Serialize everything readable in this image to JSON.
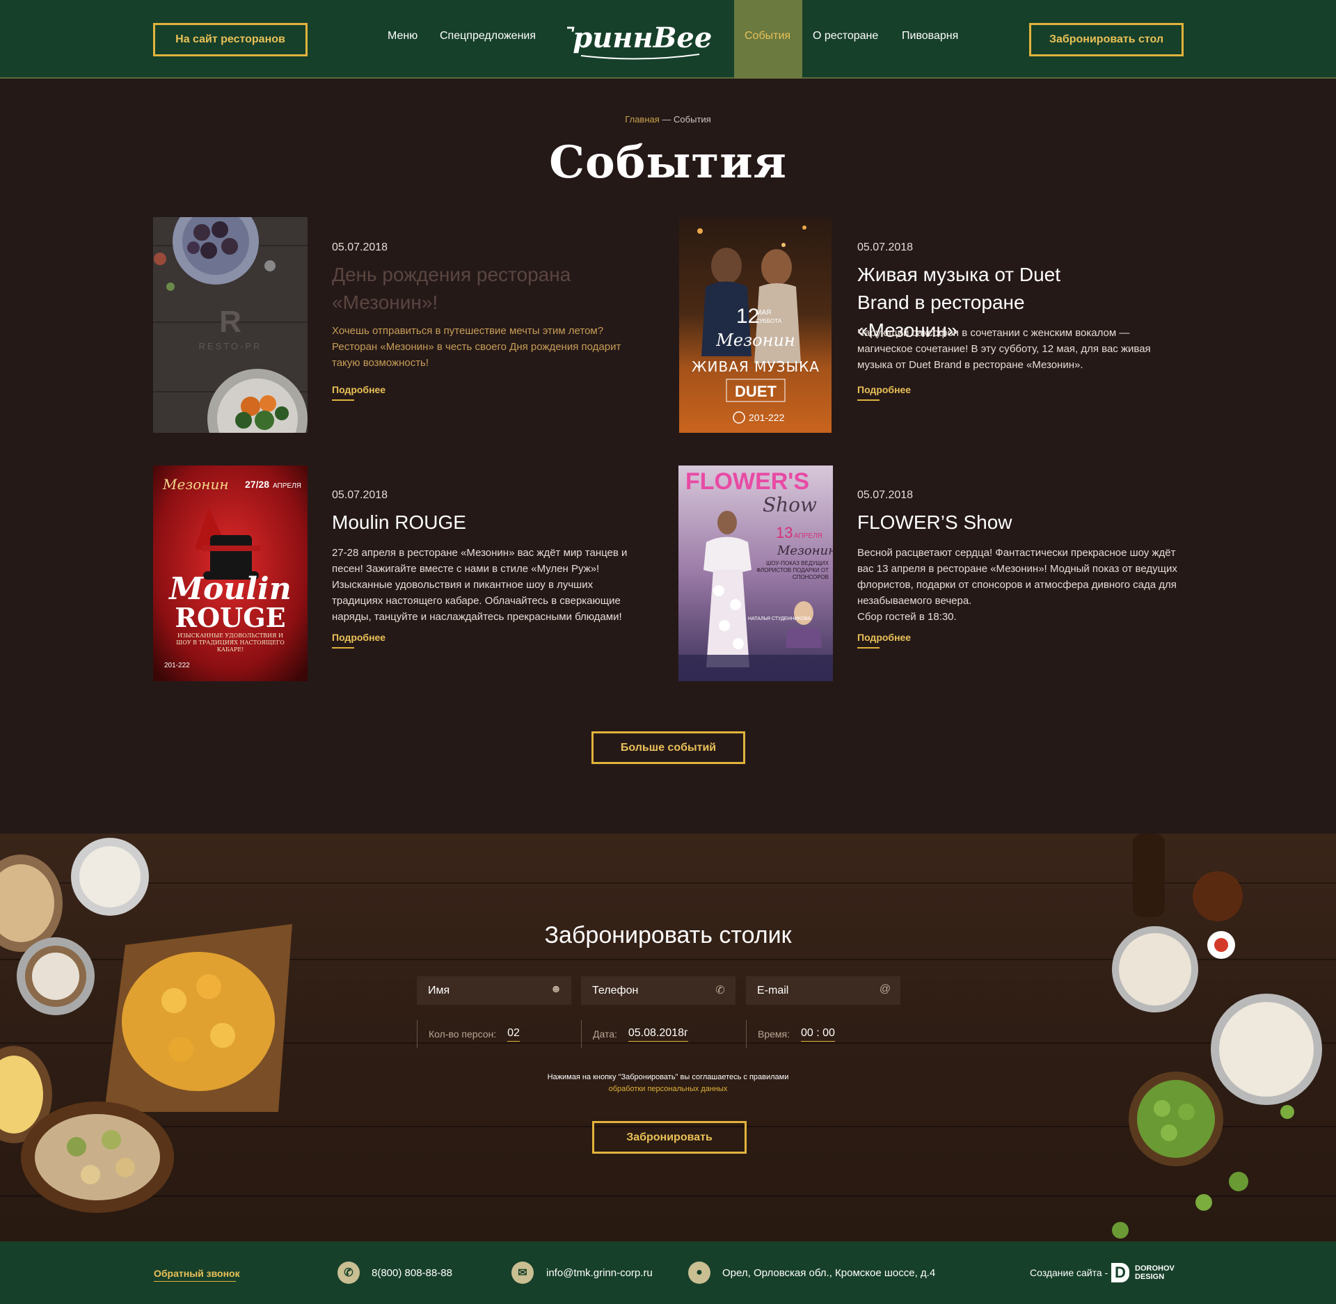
{
  "header": {
    "restaurants_site_label": "На сайт ресторанов",
    "book_table_label": "Забронировать стол",
    "logo_text": "ГриннBeer",
    "nav": [
      {
        "label": "Меню"
      },
      {
        "label": "Спецпредложения"
      },
      {
        "label": "События",
        "active": true
      },
      {
        "label": "О ресторане"
      },
      {
        "label": "Пивоварня"
      }
    ]
  },
  "breadcrumb": {
    "home": "Главная",
    "separator": "—",
    "current": "События"
  },
  "page_title": "События",
  "events": [
    {
      "date": "05.07.2018",
      "title": "День рождения ресторана «Мезонин»!",
      "description": "Хочешь отправиться в путешествие мечты этим летом? Ресторан «Мезонин» в честь своего Дня рождения подарит такую возможность!",
      "more": "Подробнее",
      "image_caption": "RESTO-PR"
    },
    {
      "date": "05.07.2018",
      "title": "Живая музыка от Duet Brand в ресторане «Мезонин»",
      "description": "Чарующий саксофон в сочетании с женским вокалом — магическое сочетание! В эту субботу, 12 мая, для вас живая музыка от Duet Brand в ресторане «Мезонин».",
      "more": "Подробнее",
      "poster": {
        "day": "12",
        "month": "МАЯ",
        "weekday": "СУББОТА",
        "venue": "Мезонин",
        "headline": "ЖИВАЯ МУЗЫКА",
        "brand": "DUET",
        "phone": "201-222"
      }
    },
    {
      "date": "05.07.2018",
      "title": "Moulin ROUGE",
      "description": "27-28 апреля в ресторане «Мезонин» вас ждёт мир танцев и песен! Зажигайте вместе с нами в стиле «Мулен Руж»! Изысканные удовольствия и пикантное шоу в лучших традициях настоящего кабаре. Облачайтесь в сверкающие наряды, танцуйте и наслаждайтесь прекрасными блюдами!",
      "more": "Подробнее",
      "poster": {
        "venue": "Мезонин",
        "dates": "27/28",
        "month": "АПРЕЛЯ",
        "line1": "Moulin",
        "line2": "ROUGE",
        "tagline": "ИЗЫСКАННЫЕ УДОВОЛЬСТВИЯ И ШОУ В ТРАДИЦИЯХ НАСТОЯЩЕГО КАБАРЕ!",
        "phone": "201-222"
      }
    },
    {
      "date": "05.07.2018",
      "title": "FLOWER’S Show",
      "description": "Весной расцветают сердца! Фантастически прекрасное шоу ждёт вас 13 апреля в ресторане «Мезонин»! Модный показ от ведущих флористов, подарки от спонсоров и атмосфера дивного сада для незабываемого вечера.\nСбор гостей в 18:30.",
      "more": "Подробнее",
      "poster": {
        "line1": "FLOWER'S",
        "line2": "Show",
        "day": "13",
        "month": "АПРЕЛЯ",
        "venue": "Мезонин",
        "info": "ШОУ-ПОКАЗ ВЕДУЩИХ ФЛОРИСТОВ ПОДАРКИ ОТ СПОНСОРОВ",
        "name": "НАТАЛЬЯ СТУДЕННИКОВА"
      }
    }
  ],
  "more_events_label": "Больше событий",
  "booking": {
    "title": "Забронировать столик",
    "name_placeholder": "Имя",
    "phone_placeholder": "Телефон",
    "email_placeholder": "E-mail",
    "persons_label": "Кол-во персон:",
    "persons_value": "02",
    "date_label": "Дата:",
    "date_value": "05.08.2018г",
    "time_label": "Время:",
    "time_value": "00 : 00",
    "consent_text": "Нажимая на кнопку \"Забронировать\" вы соглашаетесь с правилами",
    "consent_link": "обработки персональных данных",
    "submit_label": "Забронировать"
  },
  "footer": {
    "callback_label": "Обратный звонок",
    "phone": "8(800) 808-88-88",
    "email": "info@tmk.grinn-corp.ru",
    "address": "Орел, Орловская обл., Кромское шоссе, д.4",
    "credit_label": "Создание сайта -",
    "credit_brand_line1": "DOROHOV",
    "credit_brand_line2": "DESIGN"
  },
  "colors": {
    "header_bg": "#17402a",
    "page_bg": "#251918",
    "accent": "#e1b33c",
    "nav_active_bg": "#6b7a3f"
  }
}
